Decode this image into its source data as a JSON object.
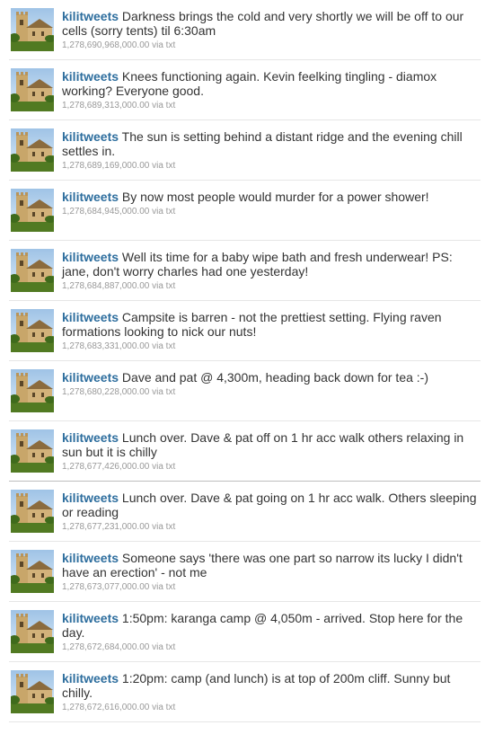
{
  "tweets": [
    {
      "user": "kilitweets",
      "text": "Darkness brings the cold and very shortly we will be off to our cells (sorry tents) til 6:30am",
      "timestamp": "1,278,690,968,000.00",
      "source": "via txt"
    },
    {
      "user": "kilitweets",
      "text": "Knees functioning again. Kevin feelking tingling - diamox working? Everyone good.",
      "timestamp": "1,278,689,313,000.00",
      "source": "via txt"
    },
    {
      "user": "kilitweets",
      "text": "The sun is setting behind a distant ridge and the evening chill settles in.",
      "timestamp": "1,278,689,169,000.00",
      "source": "via txt"
    },
    {
      "user": "kilitweets",
      "text": "By now most people would murder for a power shower!",
      "timestamp": "1,278,684,945,000.00",
      "source": "via txt"
    },
    {
      "user": "kilitweets",
      "text": "Well its time for a baby wipe bath and fresh underwear! PS: jane, don't worry charles had one yesterday!",
      "timestamp": "1,278,684,887,000.00",
      "source": "via txt"
    },
    {
      "user": "kilitweets",
      "text": "Campsite is barren - not the prettiest setting. Flying raven formations looking to nick our nuts!",
      "timestamp": "1,278,683,331,000.00",
      "source": "via txt"
    },
    {
      "user": "kilitweets",
      "text": "Dave and pat @ 4,300m, heading back down for tea :-)",
      "timestamp": "1,278,680,228,000.00",
      "source": "via txt"
    },
    {
      "user": "kilitweets",
      "text": "Lunch over. Dave & pat off on 1 hr acc walk others relaxing in sun but it is chilly",
      "timestamp": "1,278,677,426,000.00",
      "source": "via txt"
    },
    {
      "user": "kilitweets",
      "text": "Lunch over. Dave & pat going on 1 hr acc walk. Others sleeping or reading",
      "timestamp": "1,278,677,231,000.00",
      "source": "via txt"
    },
    {
      "user": "kilitweets",
      "text": "Someone says 'there was one part so narrow its lucky I didn't have an erection' - not me",
      "timestamp": "1,278,673,077,000.00",
      "source": "via txt"
    },
    {
      "user": "kilitweets",
      "text": "1:50pm: karanga camp @ 4,050m - arrived. Stop here for the day.",
      "timestamp": "1,278,672,684,000.00",
      "source": "via txt"
    },
    {
      "user": "kilitweets",
      "text": "1:20pm: camp (and lunch) is at top of 200m cliff. Sunny but chilly.",
      "timestamp": "1,278,672,616,000.00",
      "source": "via txt"
    }
  ],
  "colors": {
    "username": "#2e6e9e",
    "text": "#333333",
    "meta": "#999999",
    "divider": "#e6e6e6"
  },
  "avatar_icon": "church-photo-icon"
}
